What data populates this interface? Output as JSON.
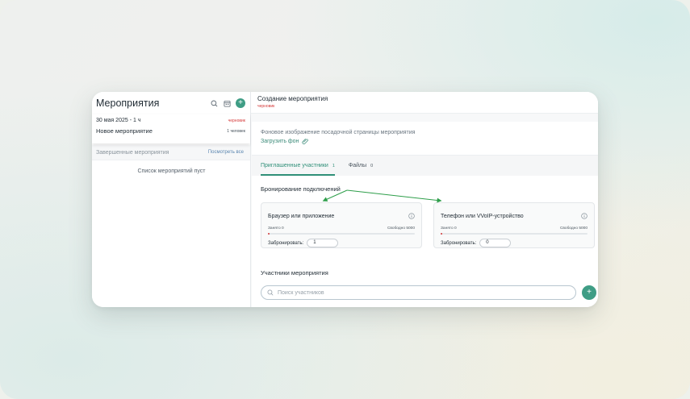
{
  "sidebar": {
    "title": "Мероприятия",
    "event": {
      "date": "30 мая 2025 - 1 ч",
      "status": "черновик",
      "name": "Новое мероприятие",
      "participants": "1 человек"
    },
    "completed": {
      "title": "Завершенные мероприятия",
      "link": "Посмотреть все"
    },
    "empty": "Список мероприятий пуст"
  },
  "main": {
    "title": "Создание мероприятия",
    "status": "черновик",
    "background": {
      "label": "Фоновое изображение посадочной страницы мероприятия",
      "upload": "Загрузить фон"
    },
    "tabs": [
      {
        "label": "Приглашенные участники",
        "count": "1"
      },
      {
        "label": "Файлы",
        "count": "0"
      }
    ],
    "booking": {
      "title": "Бронирование подключений",
      "cards": [
        {
          "title": "Браузер или приложение",
          "busy": "Занято 0",
          "free": "Свободно 5000",
          "book_label": "Забронировать:",
          "value": "1"
        },
        {
          "title": "Телефон или VVoIP-устройство",
          "busy": "Занято 0",
          "free": "Свободно 5000",
          "book_label": "Забронировать:",
          "value": "0"
        }
      ]
    },
    "participants": {
      "title": "Участники мероприятия",
      "search_placeholder": "Поиск участников"
    }
  },
  "colors": {
    "accent": "#3f9d85",
    "draft": "#d53a3a",
    "annotation_arrow": "#2e9e4a"
  }
}
